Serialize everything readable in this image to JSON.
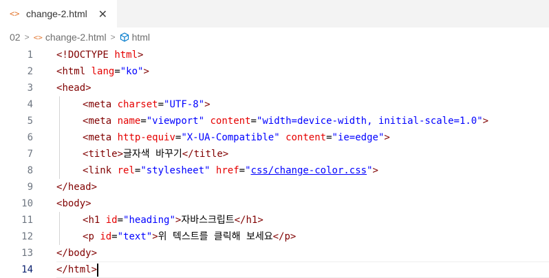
{
  "tab": {
    "label": "change-2.html",
    "close_glyph": "✕",
    "icon": "html-file-icon"
  },
  "breadcrumb": {
    "folder": "02",
    "file": "change-2.html",
    "symbol": "html"
  },
  "line_numbers": [
    "1",
    "2",
    "3",
    "4",
    "5",
    "6",
    "7",
    "8",
    "9",
    "10",
    "11",
    "12",
    "13",
    "14"
  ],
  "active_line": 14,
  "code": {
    "l1": {
      "open": "<!",
      "tag": "DOCTYPE",
      "sp": " ",
      "attr": "html",
      "close": ">"
    },
    "l2": {
      "open": "<",
      "tag": "html",
      "sp": " ",
      "a1": "lang",
      "eq": "=",
      "v1": "\"ko\"",
      "close": ">"
    },
    "l3": {
      "open": "<",
      "tag": "head",
      "close": ">"
    },
    "l4": {
      "open": "<",
      "tag": "meta",
      "sp": " ",
      "a1": "charset",
      "eq": "=",
      "v1": "\"UTF-8\"",
      "close": ">"
    },
    "l5": {
      "open": "<",
      "tag": "meta",
      "sp": " ",
      "a1": "name",
      "eq": "=",
      "v1": "\"viewport\"",
      "sp2": " ",
      "a2": "content",
      "eq2": "=",
      "v2": "\"width=device-width, initial-scale=1.0\"",
      "close": ">"
    },
    "l6": {
      "open": "<",
      "tag": "meta",
      "sp": " ",
      "a1": "http-equiv",
      "eq": "=",
      "v1": "\"X-UA-Compatible\"",
      "sp2": " ",
      "a2": "content",
      "eq2": "=",
      "v2": "\"ie=edge\"",
      "close": ">"
    },
    "l7": {
      "open": "<",
      "tag": "title",
      "close": ">",
      "text": "글자색 바꾸기",
      "eopen": "</",
      "etag": "title",
      "eclose": ">"
    },
    "l8": {
      "open": "<",
      "tag": "link",
      "sp": " ",
      "a1": "rel",
      "eq": "=",
      "v1": "\"stylesheet\"",
      "sp2": " ",
      "a2": "href",
      "eq2": "=",
      "q1": "\"",
      "v2": "css/change-color.css",
      "q2": "\"",
      "close": ">"
    },
    "l9": {
      "open": "</",
      "tag": "head",
      "close": ">"
    },
    "l10": {
      "open": "<",
      "tag": "body",
      "close": ">"
    },
    "l11": {
      "open": "<",
      "tag": "h1",
      "sp": " ",
      "a1": "id",
      "eq": "=",
      "v1": "\"heading\"",
      "close": ">",
      "text": "자바스크립트",
      "eopen": "</",
      "etag": "h1",
      "eclose": ">"
    },
    "l12": {
      "open": "<",
      "tag": "p",
      "sp": " ",
      "a1": "id",
      "eq": "=",
      "v1": "\"text\"",
      "close": ">",
      "text": "위 텍스트를 클릭해 보세요",
      "eopen": "</",
      "etag": "p",
      "eclose": ">"
    },
    "l13": {
      "open": "</",
      "tag": "body",
      "close": ">"
    },
    "l14": {
      "open": "</",
      "tag": "html",
      "close": ">"
    }
  },
  "colors": {
    "tag": "#800000",
    "attribute": "#e50000",
    "value": "#0000ff",
    "html_icon": "#e37933",
    "cube_icon": "#007acc"
  }
}
